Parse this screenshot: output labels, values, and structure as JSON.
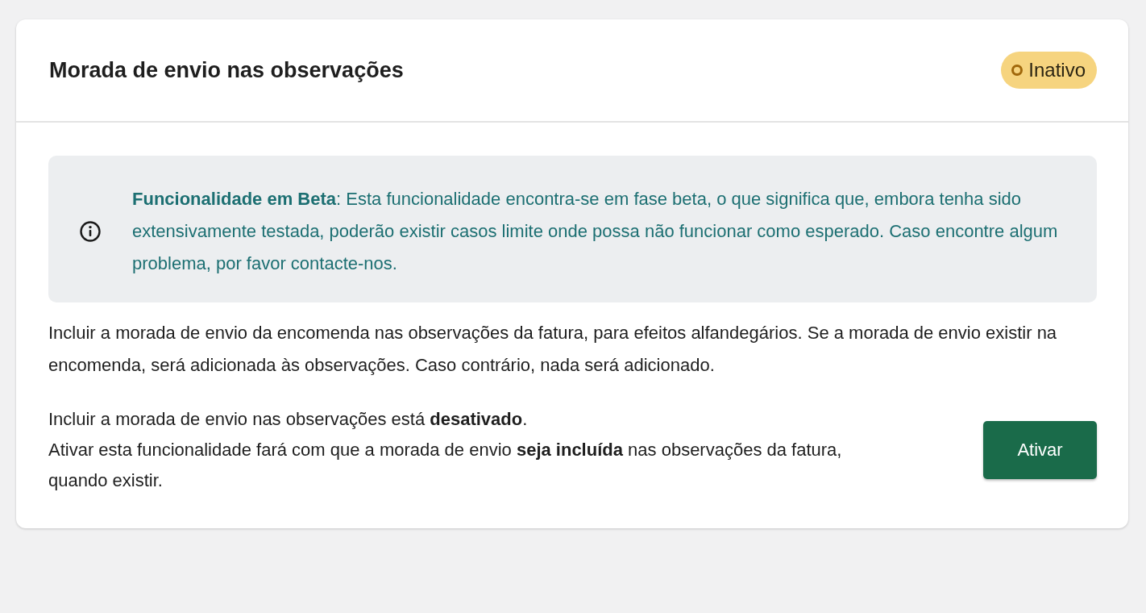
{
  "card": {
    "title": "Morada de envio nas observações",
    "status": {
      "label": "Inativo",
      "active": false
    },
    "notice": {
      "text": "**Funcionalidade em Beta**: Esta funcionalidade encontra-se em fase beta, o que significa que, embora tenha sido extensivamente testada, poderão existir casos limite onde possa não funcionar como esperado. Caso encontre algum problema, por favor contacte-nos."
    },
    "description": "Incluir a morada de envio da encomenda nas observações da fatura, para efeitos alfandegários. Se a morada de envio existir na encomenda, será adicionada às observações. Caso contrário, nada será adicionado.",
    "state_lines": [
      "Incluir a morada de envio nas observações está **desativado**.",
      "Ativar esta funcionalidade fará com que a morada de envio **seja incluída** nas observações da fatura, quando existir."
    ],
    "button": {
      "label": "Ativar"
    }
  }
}
